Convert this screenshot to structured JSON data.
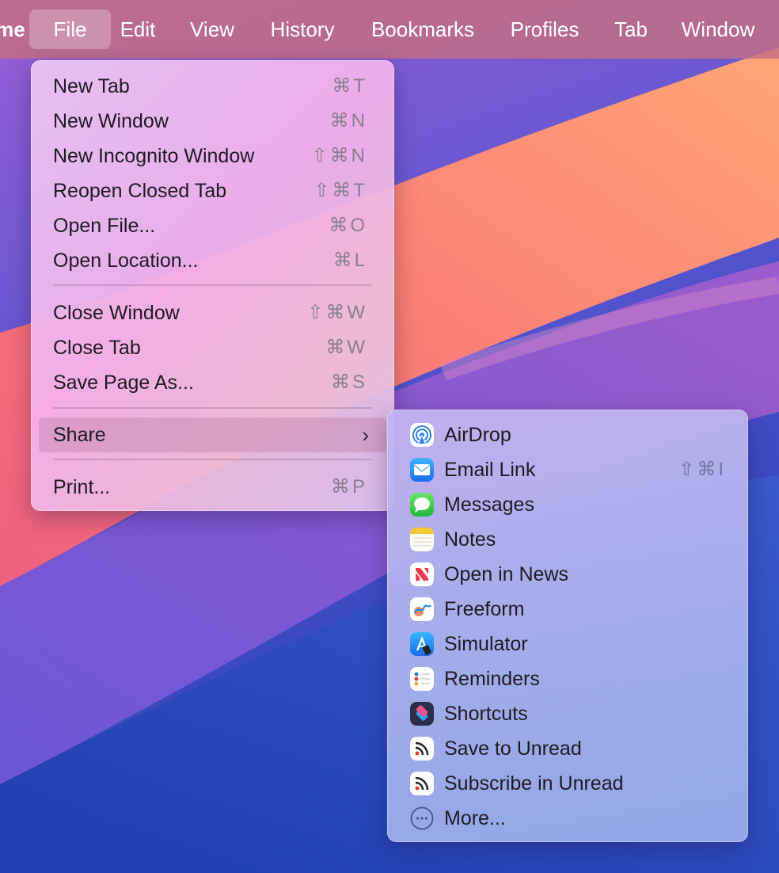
{
  "menubar": {
    "items": [
      "me",
      "File",
      "Edit",
      "View",
      "History",
      "Bookmarks",
      "Profiles",
      "Tab",
      "Window"
    ],
    "active": "File"
  },
  "file_menu": {
    "items": [
      {
        "label": "New Tab",
        "shortcut": "⌘T"
      },
      {
        "label": "New Window",
        "shortcut": "⌘N"
      },
      {
        "label": "New Incognito Window",
        "shortcut": "⇧⌘N"
      },
      {
        "label": "Reopen Closed Tab",
        "shortcut": "⇧⌘T"
      },
      {
        "label": "Open File...",
        "shortcut": "⌘O"
      },
      {
        "label": "Open Location...",
        "shortcut": "⌘L"
      },
      {
        "label": "Close Window",
        "shortcut": "⇧⌘W"
      },
      {
        "label": "Close Tab",
        "shortcut": "⌘W"
      },
      {
        "label": "Save Page As...",
        "shortcut": "⌘S"
      },
      {
        "label": "Share",
        "submenu_indicator": "›"
      },
      {
        "label": "Print...",
        "shortcut": "⌘P"
      }
    ]
  },
  "share_menu": {
    "items": [
      {
        "label": "AirDrop",
        "icon": "airdrop-icon"
      },
      {
        "label": "Email Link",
        "icon": "mail-icon",
        "shortcut": "⇧⌘I"
      },
      {
        "label": "Messages",
        "icon": "messages-icon"
      },
      {
        "label": "Notes",
        "icon": "notes-icon"
      },
      {
        "label": "Open in News",
        "icon": "news-icon"
      },
      {
        "label": "Freeform",
        "icon": "freeform-icon"
      },
      {
        "label": "Simulator",
        "icon": "simulator-icon"
      },
      {
        "label": "Reminders",
        "icon": "reminders-icon"
      },
      {
        "label": "Shortcuts",
        "icon": "shortcuts-icon"
      },
      {
        "label": "Save to Unread",
        "icon": "unread-rss-icon"
      },
      {
        "label": "Subscribe in Unread",
        "icon": "unread-rss-icon"
      },
      {
        "label": "More...",
        "icon": "more-ellipsis-icon"
      }
    ]
  },
  "colors": {
    "menubar": "#c46e82",
    "wallpaper_orange": "#f98a6e",
    "wallpaper_purple": "#8d5fd2",
    "wallpaper_blue": "#2f4fc6"
  }
}
